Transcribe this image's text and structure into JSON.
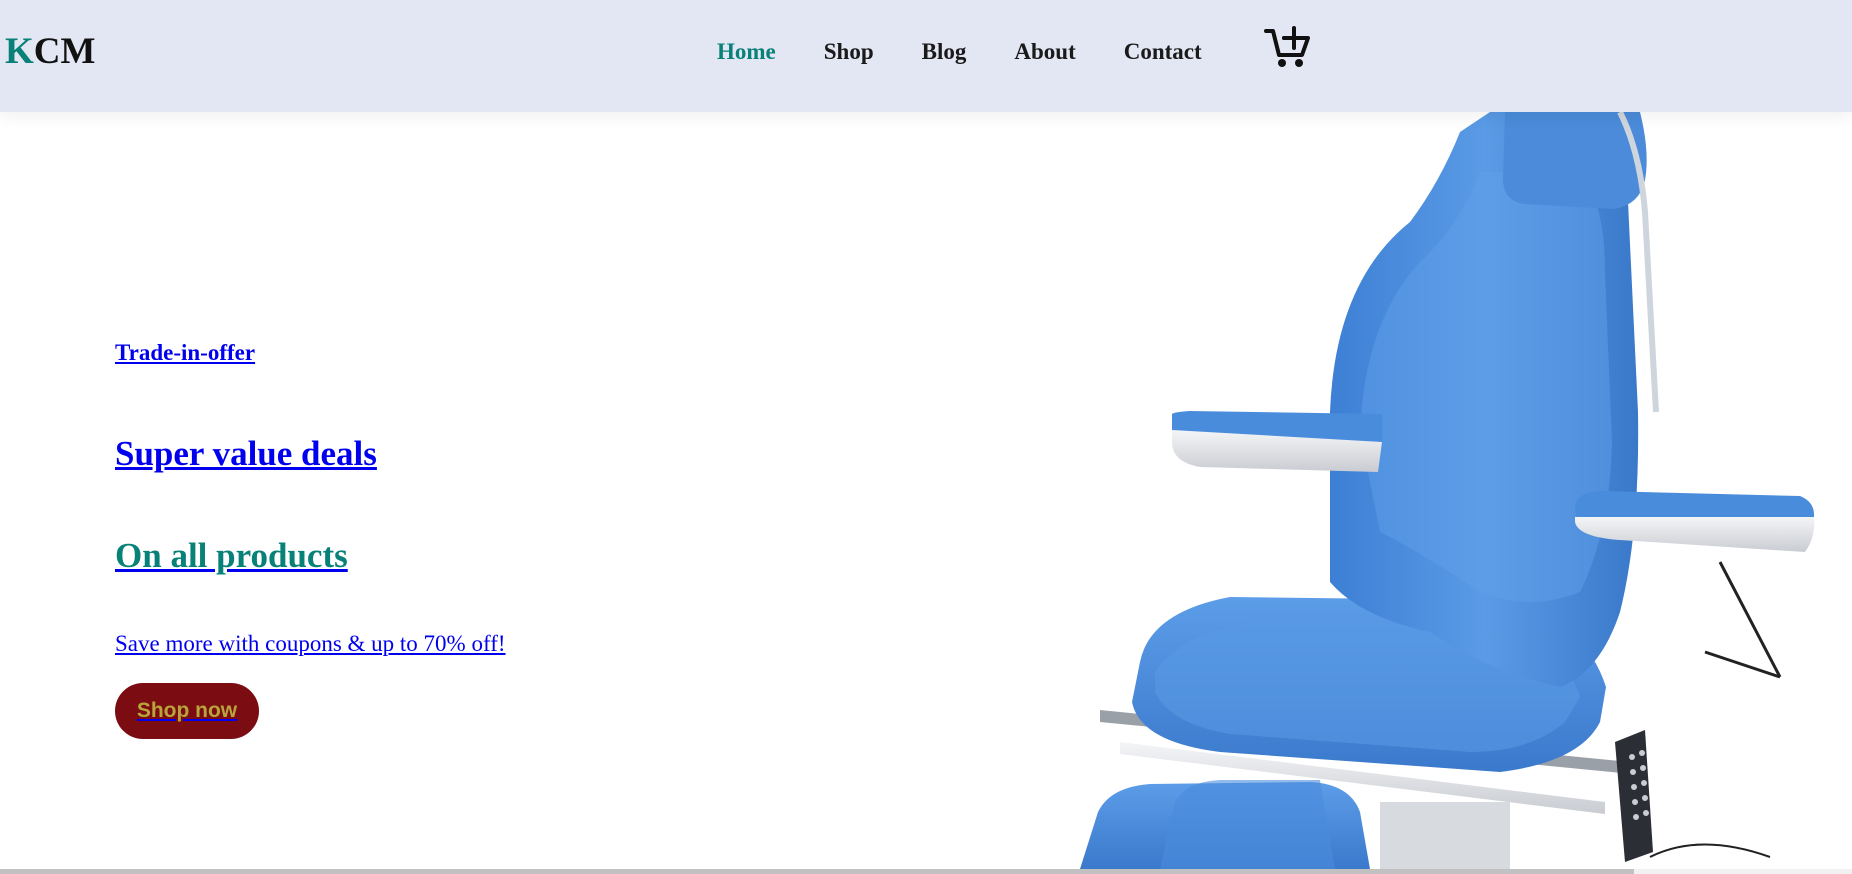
{
  "header": {
    "logo_first": "K",
    "logo_rest": "CM",
    "nav": [
      {
        "label": "Home",
        "active": true
      },
      {
        "label": "Shop",
        "active": false
      },
      {
        "label": "Blog",
        "active": false
      },
      {
        "label": "About",
        "active": false
      },
      {
        "label": "Contact",
        "active": false
      }
    ],
    "cart_icon": "cart-plus-icon"
  },
  "hero": {
    "offer": "Trade-in-offer",
    "headline": "Super value deals",
    "subheadline": "On all products",
    "tagline": "Save more with coupons & up to 70% off!",
    "button_label": "Shop now",
    "image": "blue-medical-examination-chair"
  },
  "colors": {
    "accent": "#088178",
    "header_bg": "#e3e6f3",
    "link": "#0000ee",
    "button_bg": "#7b0c11",
    "button_text": "#b8a43a",
    "chair_blue": "#4a8cdc"
  }
}
